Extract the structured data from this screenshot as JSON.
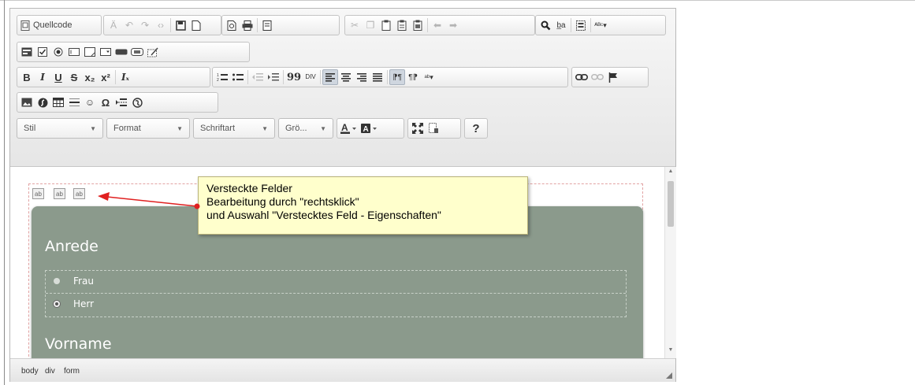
{
  "toolbar": {
    "row1": {
      "source_label": "Quellcode",
      "icons": [
        "template-icon",
        "undo-icon",
        "redo-icon",
        "code-icon",
        "save-icon",
        "new-page-icon",
        "preview-icon",
        "print-icon",
        "templates-icon",
        "cut-icon",
        "copy-icon",
        "paste-icon",
        "paste-text-icon",
        "paste-word-icon",
        "back-icon",
        "forward-icon",
        "find-icon",
        "replace-icon",
        "select-all-icon",
        "spellcheck-icon"
      ]
    },
    "row3": {
      "bold": "B",
      "italic": "I",
      "underline": "U",
      "strike": "S",
      "subscript": "x₂",
      "superscript": "x²",
      "remove_format": "Iₓ",
      "blockquote": "99"
    },
    "row5": {
      "style": "Stil",
      "format": "Format",
      "font": "Schriftart",
      "size": "Grö...",
      "help": "?"
    }
  },
  "content": {
    "hidden_fields": [
      "ab",
      "ab",
      "ab"
    ],
    "label_salutation": "Anrede",
    "options": [
      "Frau",
      "Herr"
    ],
    "label_firstname": "Vorname"
  },
  "callout": {
    "line1": "Versteckte Felder",
    "line2": "Bearbeitung durch \"rechtsklick\"",
    "line3": "und Auswahl \"Verstecktes Feld - Eigenschaften\""
  },
  "statusbar": {
    "path": [
      "body",
      "div",
      "form"
    ]
  },
  "colors": {
    "form_background": "#8b9a8c",
    "callout_background": "#ffffcc",
    "arrow": "#e02020"
  }
}
